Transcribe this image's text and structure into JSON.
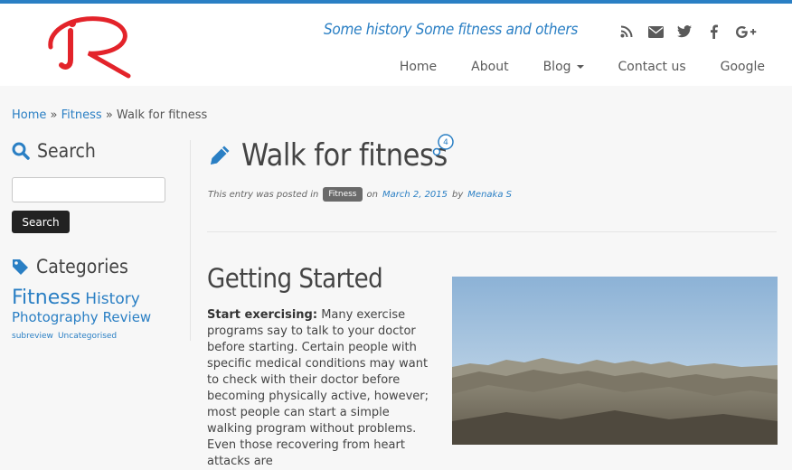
{
  "header": {
    "tagline": "Some history Some fitness and others",
    "social": [
      "rss-icon",
      "envelope-icon",
      "twitter-icon",
      "facebook-icon",
      "google-plus-icon"
    ],
    "nav": [
      {
        "label": "Home"
      },
      {
        "label": "About"
      },
      {
        "label": "Blog"
      },
      {
        "label": "Contact us"
      },
      {
        "label": "Google"
      }
    ],
    "accent": "#2a7fc4",
    "logo_color": "#e3232a"
  },
  "breadcrumb": {
    "home": "Home",
    "sep1": "»",
    "category": "Fitness",
    "sep2": "»",
    "current": "Walk for fitness"
  },
  "sidebar": {
    "search_title": "Search",
    "search_placeholder": "",
    "search_button": "Search",
    "categories_title": "Categories",
    "tags": [
      "Fitness",
      "History",
      "Photography",
      "Review",
      "subreview",
      "Uncategorised"
    ]
  },
  "post": {
    "title": "Walk for fitness",
    "comment_count": "4",
    "meta_prefix": "This entry was posted in",
    "category": "Fitness",
    "meta_on": "on",
    "date": "March 2, 2015",
    "meta_by": "by",
    "author": "Menaka S",
    "section_heading": "Getting Started",
    "lead_label": "Start exercising:",
    "body": "Many exercise programs say to talk to your doctor before starting. Certain people with specific medical conditions may want to check with their doctor before becoming physically active, however; most people can start a simple walking program without problems. Even those recovering from heart attacks are"
  }
}
